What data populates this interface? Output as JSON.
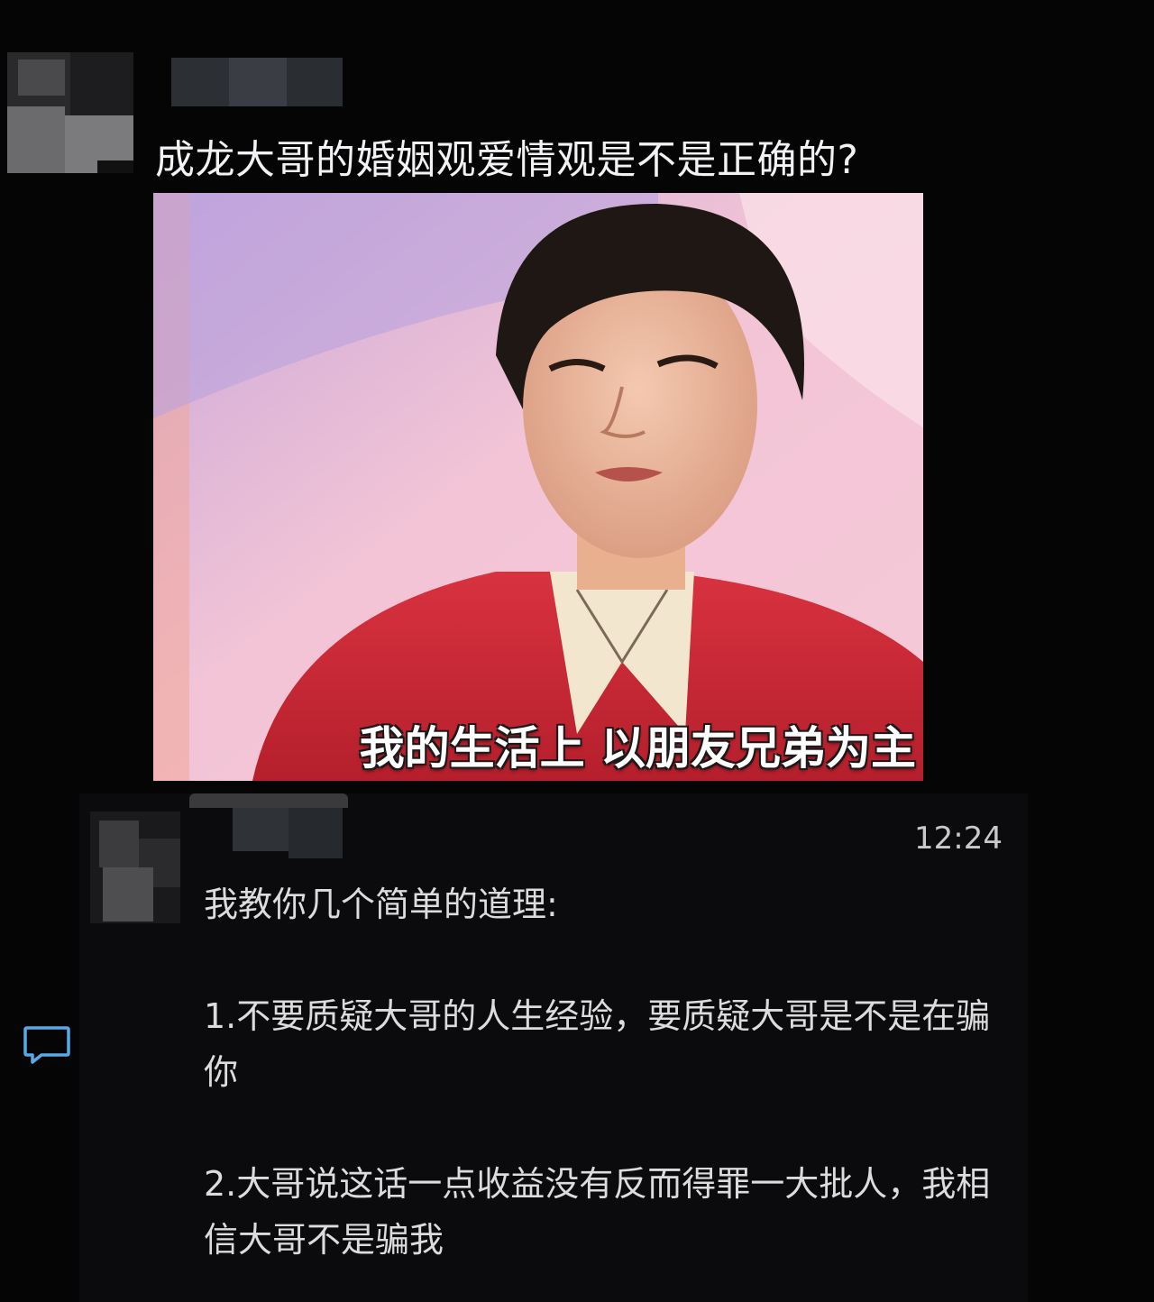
{
  "post": {
    "author_avatar_icon": "avatar-icon",
    "title": "成龙大哥的婚姻观爱情观是不是正确的?",
    "video": {
      "caption": "我的生活上 以朋友兄弟为主"
    }
  },
  "reply": {
    "author_avatar_icon": "avatar-icon",
    "time": "12:24",
    "intro": "我教你几个简单的道理:",
    "points": [
      "1.不要质疑大哥的人生经验，要质疑大哥是不是在骗你",
      "2.大哥说这话一点收益没有反而得罪一大批人，我相信大哥不是骗我"
    ],
    "comment_icon": "comment-icon"
  },
  "colors": {
    "background": "#050506",
    "text": "#e8e8ea",
    "accent_icon": "#5aa9e6"
  }
}
